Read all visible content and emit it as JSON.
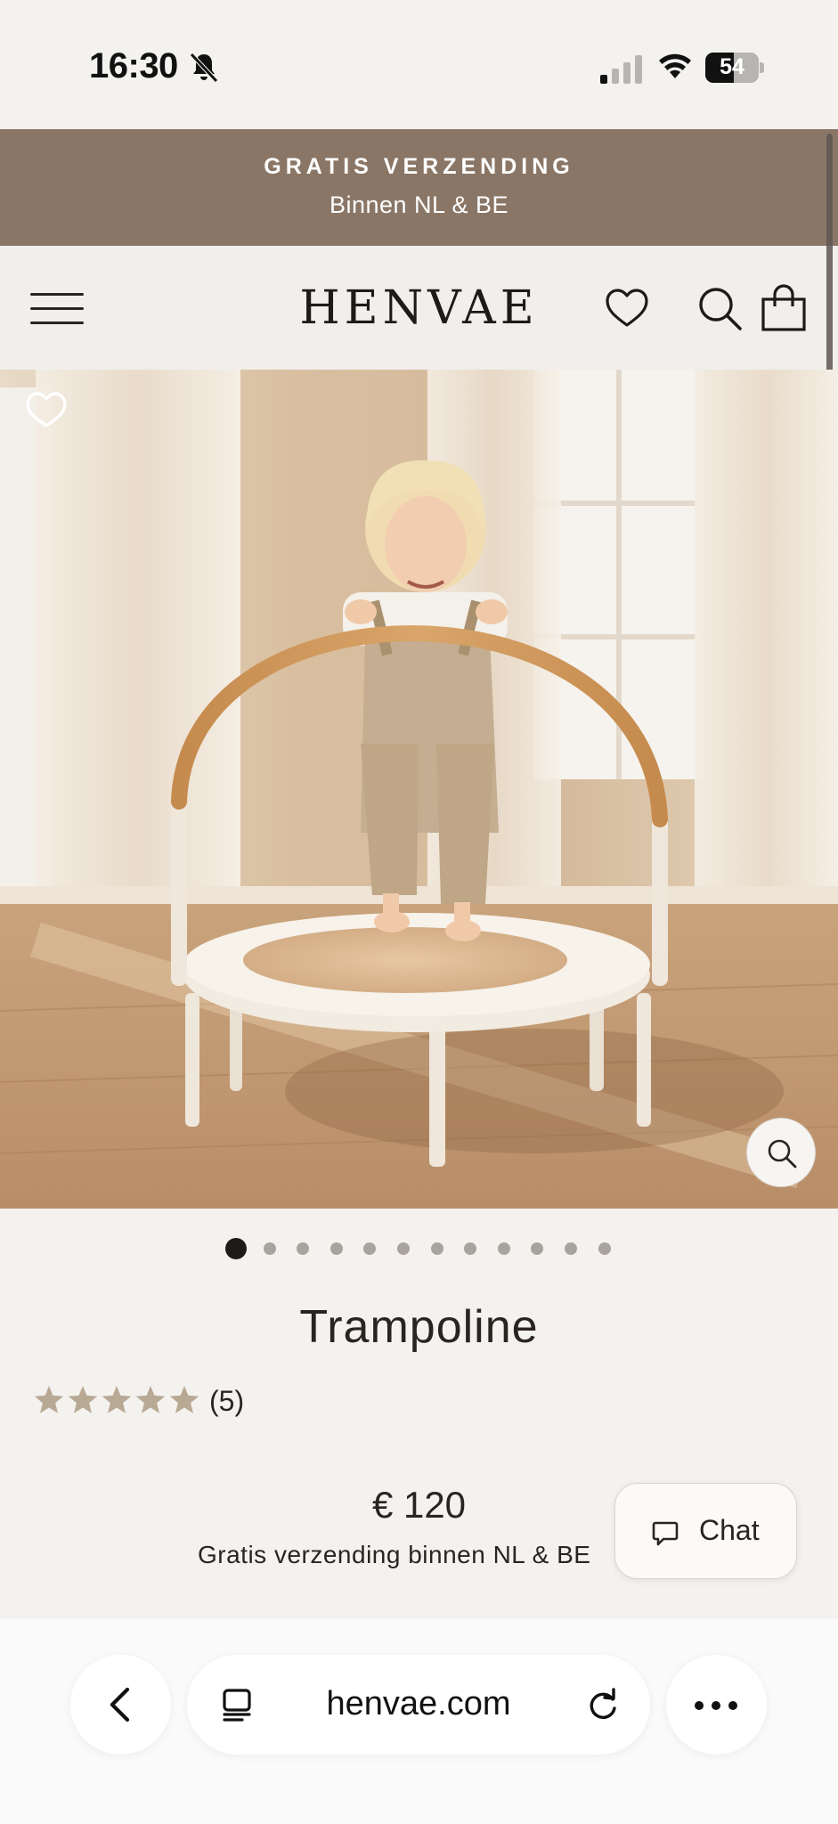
{
  "status_bar": {
    "time": "16:30",
    "battery_level": "54",
    "icons": [
      "bell-slash-icon",
      "signal-icon",
      "wifi-icon",
      "battery-icon"
    ]
  },
  "announcement": {
    "title": "GRATIS VERZENDING",
    "subtitle": "Binnen NL & BE"
  },
  "header": {
    "logo": "HENVAE",
    "icons": [
      "menu-icon",
      "heart-icon",
      "search-icon",
      "shopping-bag-icon"
    ]
  },
  "gallery": {
    "image_count": 12,
    "active_index": 0,
    "icons": [
      "heart-outline-icon",
      "zoom-icon"
    ]
  },
  "product": {
    "title": "Trampoline",
    "rating_stars": 5,
    "rating_count": "(5)",
    "price": "€ 120",
    "shipping": "Gratis verzending binnen NL & BE"
  },
  "chat": {
    "label": "Chat"
  },
  "browser": {
    "url": "henvae.com",
    "icons": [
      "back-chevron-icon",
      "tabs-icon",
      "reload-icon",
      "more-icon"
    ]
  },
  "colors": {
    "background": "#f4f2ef",
    "announcement_bg": "#8a7666",
    "text": "#2a2420",
    "star": "#b8a994"
  }
}
